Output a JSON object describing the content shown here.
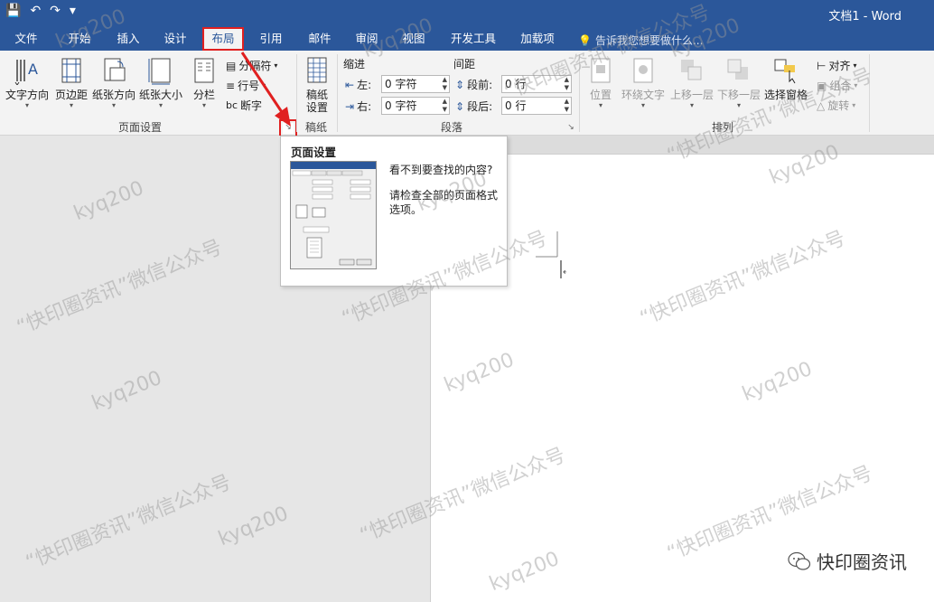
{
  "title_bar": {
    "doc_title": "文档1 - Word"
  },
  "tabs": [
    {
      "label": "文件"
    },
    {
      "label": "开始"
    },
    {
      "label": "插入"
    },
    {
      "label": "设计"
    },
    {
      "label": "布局"
    },
    {
      "label": "引用"
    },
    {
      "label": "邮件"
    },
    {
      "label": "审阅"
    },
    {
      "label": "视图"
    },
    {
      "label": "开发工具"
    },
    {
      "label": "加载项"
    }
  ],
  "tell_me": "告诉我您想要做什么...",
  "ribbon": {
    "page_setup": {
      "label": "页面设置",
      "text_direction": "文字方向",
      "margins": "页边距",
      "orientation": "纸张方向",
      "size": "纸张大小",
      "columns": "分栏",
      "breaks": "分隔符",
      "line_numbers": "行号",
      "hyphenation": "断字"
    },
    "draft_paper": {
      "label": "稿纸",
      "setup_line1": "稿纸",
      "setup_line2": "设置"
    },
    "paragraph": {
      "label": "段落",
      "indent_header": "缩进",
      "spacing_header": "间距",
      "left_label": "左:",
      "right_label": "右:",
      "left_value": "0 字符",
      "right_value": "0 字符",
      "before_label": "段前:",
      "after_label": "段后:",
      "before_value": "0 行",
      "after_value": "0 行"
    },
    "arrange": {
      "label": "排列",
      "position": "位置",
      "wrap_text": "环绕文字",
      "bring_forward": "上移一层",
      "send_backward": "下移一层",
      "selection_pane": "选择窗格",
      "align": "对齐",
      "group": "组合",
      "rotate": "旋转"
    }
  },
  "tooltip": {
    "title": "页面设置",
    "line1": "看不到要查找的内容?",
    "line2": "请检查全部的页面格式选项。"
  },
  "watermark": {
    "kyq": "kyq200",
    "wechat": "“快印圈资讯”微信公众号"
  },
  "brand": "快印圈资讯"
}
